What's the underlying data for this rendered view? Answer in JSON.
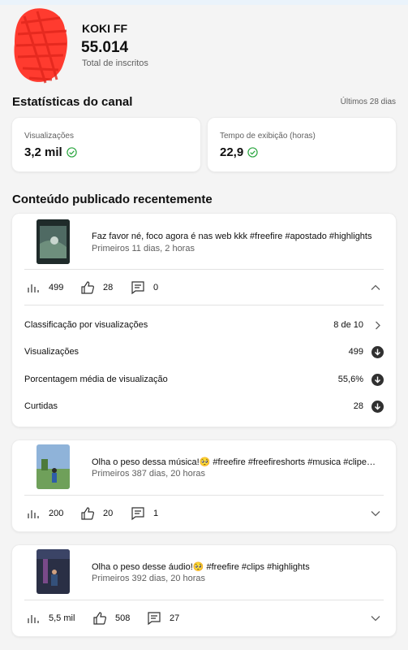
{
  "channel": {
    "name": "KOKI FF",
    "subscribers": "55.014",
    "subscribers_label": "Total de inscritos"
  },
  "stats": {
    "title": "Estatísticas do canal",
    "period": "Últimos 28 dias",
    "views_label": "Visualizações",
    "views_value": "3,2 mil",
    "watch_label": "Tempo de exibição (horas)",
    "watch_value": "22,9"
  },
  "recent": {
    "title": "Conteúdo publicado recentemente",
    "videos": [
      {
        "title": "Faz favor né, foco agora é nas web kkk #freefire #apostado #highlights",
        "period": "Primeiros 11 dias, 2 horas",
        "views": "499",
        "likes": "28",
        "comments": "0",
        "expanded": true
      },
      {
        "title": "Olha o peso dessa música!🥺 #freefire #freefireshorts #musica #clipe…",
        "period": "Primeiros 387 dias, 20 horas",
        "views": "200",
        "likes": "20",
        "comments": "1",
        "expanded": false
      },
      {
        "title": "Olha o peso desse áudio!🥺 #freefire #clips #highlights",
        "period": "Primeiros 392 dias, 20 horas",
        "views": "5,5 mil",
        "likes": "508",
        "comments": "27",
        "expanded": false
      }
    ],
    "details": [
      {
        "label": "Classificação por visualizações",
        "value": "8 de 10"
      },
      {
        "label": "Visualizações",
        "value": "499"
      },
      {
        "label": "Porcentagem média de visualização",
        "value": "55,6%"
      },
      {
        "label": "Curtidas",
        "value": "28"
      }
    ]
  }
}
